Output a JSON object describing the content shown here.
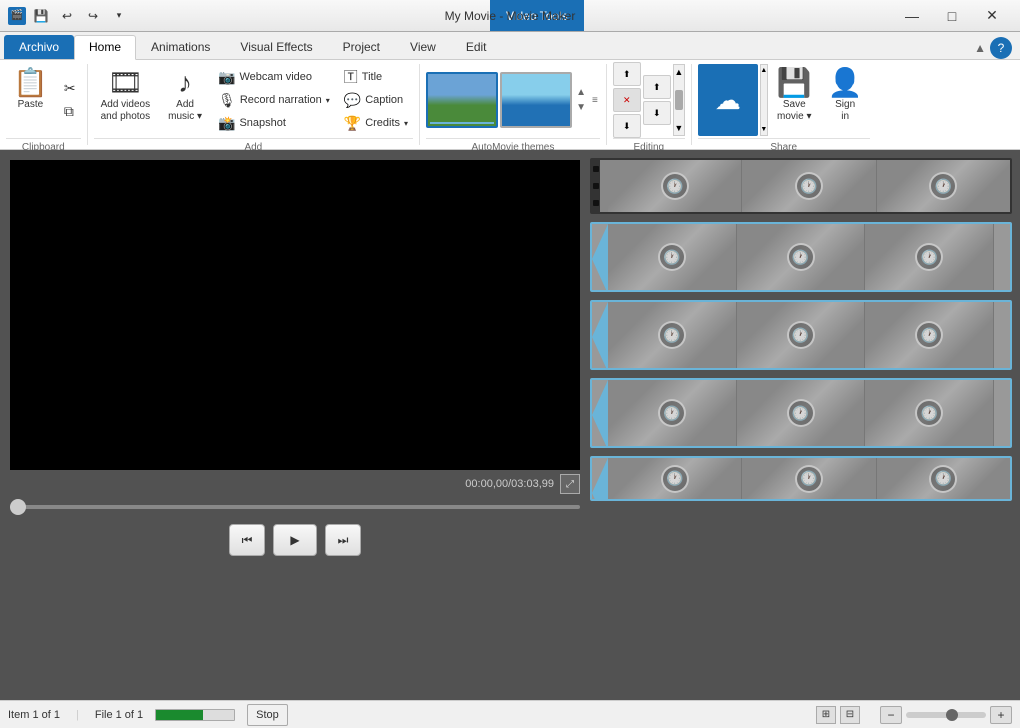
{
  "titleBar": {
    "title": "My Movie - Movie Maker",
    "videoToolsLabel": "Video Tools",
    "minimizeIcon": "—",
    "maximizeIcon": "□",
    "closeIcon": "✕"
  },
  "tabs": [
    {
      "id": "archivo",
      "label": "Archivo",
      "active": false,
      "special": true
    },
    {
      "id": "home",
      "label": "Home",
      "active": true
    },
    {
      "id": "animations",
      "label": "Animations",
      "active": false
    },
    {
      "id": "visual-effects",
      "label": "Visual Effects",
      "active": false
    },
    {
      "id": "project",
      "label": "Project",
      "active": false
    },
    {
      "id": "view",
      "label": "View",
      "active": false
    },
    {
      "id": "edit",
      "label": "Edit",
      "active": false
    }
  ],
  "ribbon": {
    "groups": [
      {
        "id": "clipboard",
        "label": "Clipboard"
      },
      {
        "id": "add",
        "label": "Add"
      },
      {
        "id": "automovie",
        "label": "AutoMovie themes"
      },
      {
        "id": "editing",
        "label": "Editing"
      },
      {
        "id": "share",
        "label": "Share"
      }
    ],
    "clipboard": {
      "pasteLabel": "Paste"
    },
    "add": {
      "addVideosLabel": "Add videos\nand photos",
      "addMusicLabel": "Add\nmusic",
      "webcamLabel": "Webcam video",
      "narrationLabel": "Record narration",
      "snapshotLabel": "Snapshot",
      "titleLabel": "Title",
      "captionLabel": "Caption",
      "creditsLabel": "Credits"
    },
    "editing": {
      "label": "Editing"
    },
    "share": {
      "saveMovieLabel": "Save\nmovie",
      "signInLabel": "Sign\nin"
    }
  },
  "preview": {
    "timeDisplay": "00:00,00/03:03,99"
  },
  "playback": {
    "prevLabel": "⏮",
    "playLabel": "▶",
    "nextLabel": "⏭"
  },
  "statusBar": {
    "item": "Item 1 of 1",
    "file": "File 1 of 1",
    "stopLabel": "Stop"
  }
}
